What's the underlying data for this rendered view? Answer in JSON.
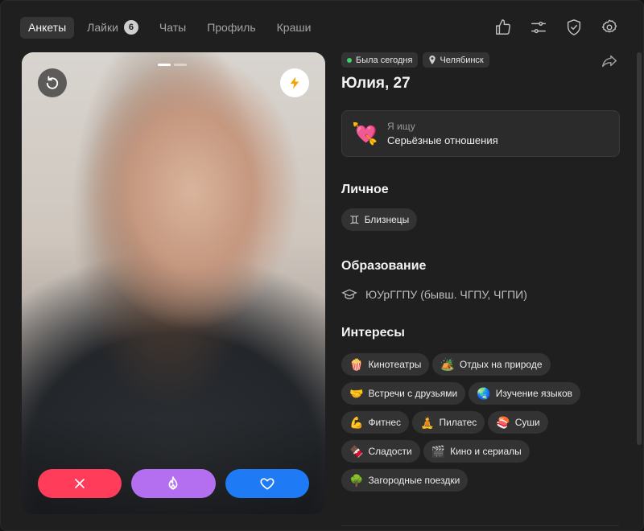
{
  "nav": {
    "tabs": [
      {
        "label": "Анкеты"
      },
      {
        "label": "Лайки",
        "badge": "6"
      },
      {
        "label": "Чаты"
      },
      {
        "label": "Профиль"
      },
      {
        "label": "Краши"
      }
    ],
    "icons": [
      "thumbs-up-icon",
      "filters-icon",
      "shield-check-icon",
      "settings-icon"
    ]
  },
  "photo": {
    "photo_count": 2,
    "current_photo": 1,
    "actions": [
      "dislike",
      "superlike",
      "like"
    ]
  },
  "profile": {
    "status": "Была сегодня",
    "city": "Челябинск",
    "name_age": "Юлия, 27",
    "looking": {
      "emoji": "💘",
      "label": "Я ищу",
      "value": "Серьёзные отношения"
    },
    "personal": {
      "title": "Личное",
      "zodiac_glyph": "♊",
      "zodiac": "Близнецы"
    },
    "education": {
      "title": "Образование",
      "value": "ЮУрГГПУ (бывш. ЧГПУ, ЧГПИ)"
    },
    "interests": {
      "title": "Интересы",
      "items": [
        {
          "emoji": "🍿",
          "label": "Кинотеатры"
        },
        {
          "emoji": "🏕️",
          "label": "Отдых на природе"
        },
        {
          "emoji": "🤝",
          "label": "Встречи с друзьями"
        },
        {
          "emoji": "🌏",
          "label": "Изучение языков"
        },
        {
          "emoji": "💪",
          "label": "Фитнес"
        },
        {
          "emoji": "🧘",
          "label": "Пилатес"
        },
        {
          "emoji": "🍣",
          "label": "Суши"
        },
        {
          "emoji": "🍫",
          "label": "Сладости"
        },
        {
          "emoji": "🎬",
          "label": "Кино и сериалы"
        },
        {
          "emoji": "🌳",
          "label": "Загородные поездки"
        }
      ]
    }
  },
  "colors": {
    "dislike": "#ff3d5a",
    "superlike": "#b46ff0",
    "like": "#1e7bf5",
    "online": "#3bd16f"
  }
}
